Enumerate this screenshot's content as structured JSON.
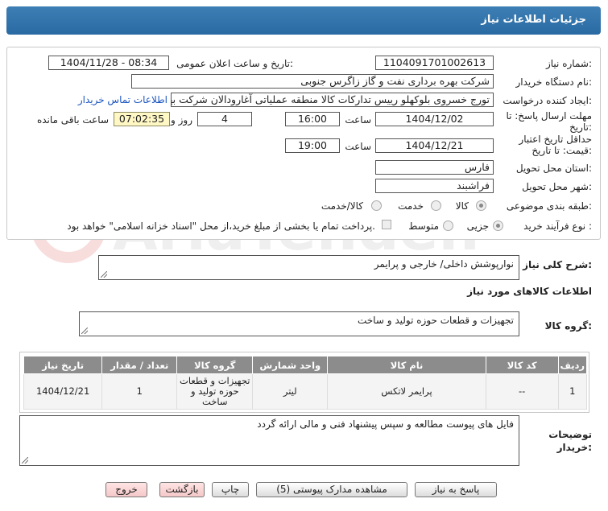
{
  "header": {
    "title": "جزئیات اطلاعات نیاز"
  },
  "form": {
    "need_number_label": "شماره نیاز:",
    "need_number": "1104091701002613",
    "announce_label": "تاریخ و ساعت اعلان عمومی:",
    "announce_value": "1404/11/28 - 08:34",
    "buyer_org_label": "نام دستگاه خریدار:",
    "buyer_org": "شرکت بهره برداری نفت و گاز زاگرس جنوبی",
    "creator_label": "ایجاد کننده درخواست:",
    "creator": "تورج خسروی بلوکهلو رییس تدارکات کالا منطقه عملیاتی آغارودالان شرکت بهره برداری",
    "contact_link": "اطلاعات تماس خریدار",
    "reply_deadline_label": "مهلت ارسال پاسخ: تا تاریخ:",
    "reply_date": "1404/12/02",
    "time_label": "ساعت",
    "reply_time": "16:00",
    "days_value": "4",
    "days_label": "روز و",
    "remaining_time": "07:02:35",
    "remaining_label": "ساعت باقی مانده",
    "validity_label": "حداقل تاریخ اعتبار قیمت: تا تاریخ:",
    "validity_date": "1404/12/21",
    "validity_time": "19:00",
    "province_label": "استان محل تحویل:",
    "province": "فارس",
    "city_label": "شهر محل تحویل:",
    "city": "فراشبند",
    "category_label": "طبقه بندی موضوعی:",
    "category_options": [
      "کالا",
      "خدمت",
      "کالا/خدمت"
    ],
    "category_selected": "کالا",
    "process_label": "نوع فرآیند خرید :",
    "process_options": [
      "جزیی",
      "متوسط"
    ],
    "process_selected": "جزیی",
    "payment_note": "پرداخت تمام یا بخشی از مبلغ خرید،از محل \"اسناد خزانه اسلامی\" خواهد بود."
  },
  "summary": {
    "label": "شرح کلی نیاز:",
    "value": "نوارپوشش داخلی/ خارجی و پرایمر"
  },
  "goods_info_title": "اطلاعات کالاهای مورد نیاز",
  "goods_group": {
    "label": "گروه کالا:",
    "value": "تجهیزات و قطعات حوزه تولید و ساخت"
  },
  "table": {
    "headers": [
      "ردیف",
      "کد کالا",
      "نام کالا",
      "واحد شمارش",
      "گروه کالا",
      "تعداد / مقدار",
      "تاریخ نیاز"
    ],
    "rows": [
      [
        "1",
        "--",
        "پرایمر لاتکس",
        "لیتر",
        "تجهیزات و قطعات حوزه تولید و ساخت",
        "1",
        "1404/12/21"
      ]
    ]
  },
  "buyer_notes": {
    "label": "توضیحات خریدار:",
    "value": "فایل های پیوست مطالعه و سپس پیشنهاد فنی و مالی ارائه گردد"
  },
  "buttons": {
    "reply": "پاسخ به نیاز",
    "view_docs": "مشاهده مدارک پیوستی (5)",
    "print": "چاپ",
    "back": "بازگشت",
    "exit": "خروج"
  },
  "watermark": "AriaTender.neT",
  "colors": {
    "header_bg": "#2f72ab",
    "link": "#1a55c0",
    "table_header": "#8c8c8c",
    "timer_bg": "#fff7c4"
  }
}
